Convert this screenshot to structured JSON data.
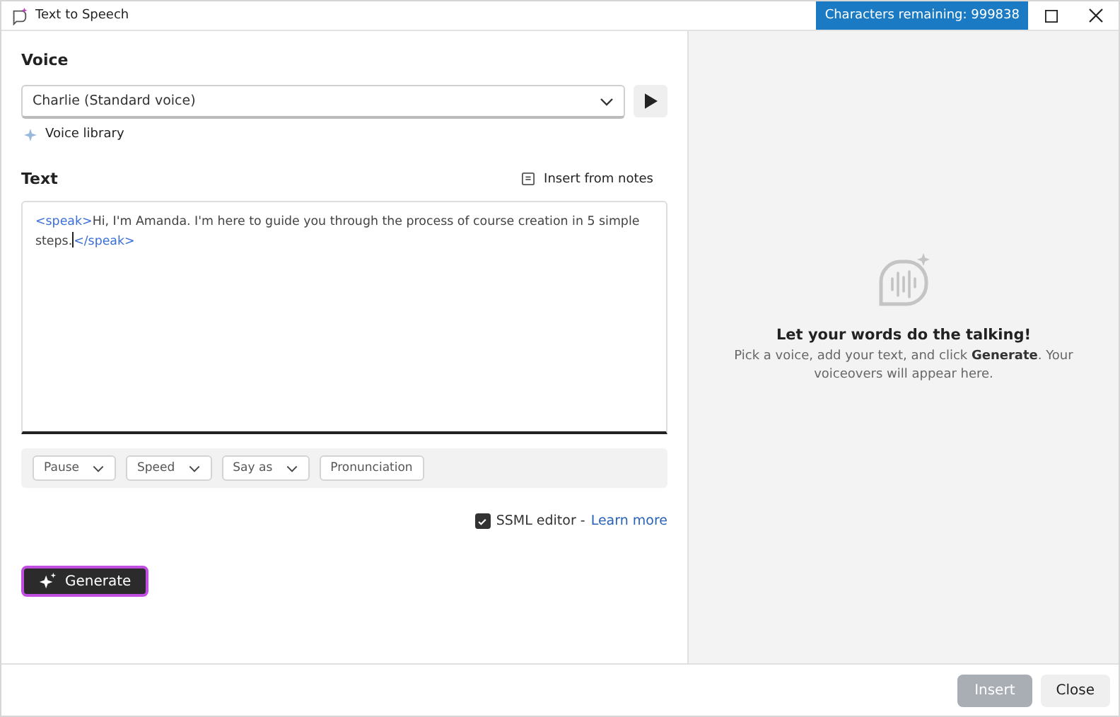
{
  "window": {
    "title": "Text to Speech",
    "badge": "Characters remaining: 999838"
  },
  "voice": {
    "label": "Voice",
    "value": "Charlie (Standard voice)",
    "library_link": "Voice library"
  },
  "text": {
    "label": "Text",
    "insert_link": "Insert from notes",
    "segments": [
      {
        "kind": "tag",
        "text": "<speak>"
      },
      {
        "kind": "text",
        "text": "Hi, I'm Amanda. I'm here to guide you through the process of course creation in 5 simple steps."
      },
      {
        "kind": "cursor"
      },
      {
        "kind": "tag",
        "text": "</speak>"
      }
    ]
  },
  "toolbar": [
    {
      "label": "Pause",
      "dropdown": true
    },
    {
      "label": "Speed",
      "dropdown": true
    },
    {
      "label": "Say as",
      "dropdown": true
    },
    {
      "label": "Pronunciation",
      "dropdown": false
    }
  ],
  "ssml": {
    "label": "SSML editor -",
    "checked": true,
    "link": "Learn more"
  },
  "generate_button": "Generate",
  "empty_state": {
    "title": "Let your words do the talking!",
    "body": "Pick a voice, add your text, and click **Generate**. Your voiceovers will appear here."
  },
  "footer": [
    {
      "label": "Insert",
      "disabled": true
    },
    {
      "label": "Close",
      "disabled": false
    }
  ]
}
